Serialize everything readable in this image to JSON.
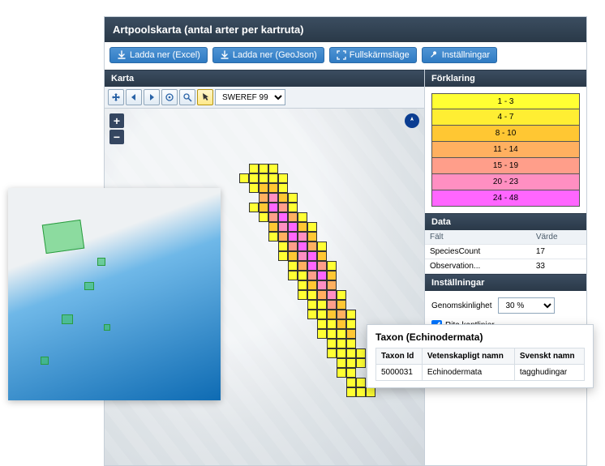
{
  "title": "Artpoolskarta (antal arter per kartruta)",
  "buttons": {
    "excel": "Ladda ner (Excel)",
    "geojson": "Ladda ner (GeoJson)",
    "fullscreen": "Fullskärmsläge",
    "settings": "Inställningar"
  },
  "sections": {
    "map": "Karta",
    "legend": "Förklaring",
    "data": "Data",
    "settings": "Inställningar"
  },
  "map": {
    "coord_sys_selected": "SWEREF 99",
    "zoom_in": "+",
    "zoom_out": "−"
  },
  "legend": {
    "bins": [
      {
        "label": "1 - 3",
        "color": "#ffff33"
      },
      {
        "label": "4 - 7",
        "color": "#ffee33"
      },
      {
        "label": "8 - 10",
        "color": "#ffc733"
      },
      {
        "label": "11 - 14",
        "color": "#ffb060"
      },
      {
        "label": "15 - 19",
        "color": "#ff9e8a"
      },
      {
        "label": "20 - 23",
        "color": "#ff8fc2"
      },
      {
        "label": "24 - 48",
        "color": "#ff66ff"
      }
    ]
  },
  "data_panel": {
    "field_header": "Fält",
    "value_header": "Värde",
    "rows": [
      {
        "field": "SpeciesCount",
        "value": "17"
      },
      {
        "field": "Observation...",
        "value": "33"
      }
    ]
  },
  "settings_panel": {
    "opacity_label": "Genomskinlighet",
    "opacity_selected": "30 %",
    "edges_label": "Rita kantlinjer",
    "edges_checked": true
  },
  "taxon": {
    "popup_title": "Taxon (Echinodermata)",
    "headers": {
      "id": "Taxon Id",
      "sci": "Vetenskapligt namn",
      "sv": "Svenskt namn"
    },
    "row": {
      "id": "5000031",
      "sci": "Echinodermata",
      "sv": "tagghudingar"
    }
  },
  "chart_data": {
    "type": "heatmap",
    "title": "Artpoolskarta (antal arter per kartruta)",
    "value_field": "SpeciesCount",
    "bins": [
      {
        "range": [
          1,
          3
        ],
        "color": "#ffff33"
      },
      {
        "range": [
          4,
          7
        ],
        "color": "#ffee33"
      },
      {
        "range": [
          8,
          10
        ],
        "color": "#ffc733"
      },
      {
        "range": [
          11,
          14
        ],
        "color": "#ffb060"
      },
      {
        "range": [
          15,
          19
        ],
        "color": "#ff9e8a"
      },
      {
        "range": [
          20,
          23
        ],
        "color": "#ff8fc2"
      },
      {
        "range": [
          24,
          48
        ],
        "color": "#ff66ff"
      }
    ],
    "grid": {
      "cols": 18,
      "rows": 30,
      "cells": [
        {
          "c": 4,
          "r": 4,
          "b": 0
        },
        {
          "c": 5,
          "r": 4,
          "b": 0
        },
        {
          "c": 6,
          "r": 4,
          "b": 0
        },
        {
          "c": 3,
          "r": 5,
          "b": 0
        },
        {
          "c": 4,
          "r": 5,
          "b": 0
        },
        {
          "c": 5,
          "r": 5,
          "b": 0
        },
        {
          "c": 6,
          "r": 5,
          "b": 0
        },
        {
          "c": 7,
          "r": 5,
          "b": 0
        },
        {
          "c": 4,
          "r": 6,
          "b": 0
        },
        {
          "c": 5,
          "r": 6,
          "b": 2
        },
        {
          "c": 6,
          "r": 6,
          "b": 2
        },
        {
          "c": 7,
          "r": 6,
          "b": 0
        },
        {
          "c": 5,
          "r": 7,
          "b": 3
        },
        {
          "c": 6,
          "r": 7,
          "b": 5
        },
        {
          "c": 7,
          "r": 7,
          "b": 2
        },
        {
          "c": 8,
          "r": 7,
          "b": 0
        },
        {
          "c": 4,
          "r": 8,
          "b": 0
        },
        {
          "c": 5,
          "r": 8,
          "b": 2
        },
        {
          "c": 6,
          "r": 8,
          "b": 6
        },
        {
          "c": 7,
          "r": 8,
          "b": 4
        },
        {
          "c": 8,
          "r": 8,
          "b": 0
        },
        {
          "c": 5,
          "r": 9,
          "b": 0
        },
        {
          "c": 6,
          "r": 9,
          "b": 4
        },
        {
          "c": 7,
          "r": 9,
          "b": 6
        },
        {
          "c": 8,
          "r": 9,
          "b": 3
        },
        {
          "c": 9,
          "r": 9,
          "b": 0
        },
        {
          "c": 6,
          "r": 10,
          "b": 2
        },
        {
          "c": 7,
          "r": 10,
          "b": 5
        },
        {
          "c": 8,
          "r": 10,
          "b": 6
        },
        {
          "c": 9,
          "r": 10,
          "b": 2
        },
        {
          "c": 10,
          "r": 10,
          "b": 0
        },
        {
          "c": 6,
          "r": 11,
          "b": 0
        },
        {
          "c": 7,
          "r": 11,
          "b": 3
        },
        {
          "c": 8,
          "r": 11,
          "b": 6
        },
        {
          "c": 9,
          "r": 11,
          "b": 5
        },
        {
          "c": 10,
          "r": 11,
          "b": 2
        },
        {
          "c": 7,
          "r": 12,
          "b": 0
        },
        {
          "c": 8,
          "r": 12,
          "b": 4
        },
        {
          "c": 9,
          "r": 12,
          "b": 6
        },
        {
          "c": 10,
          "r": 12,
          "b": 3
        },
        {
          "c": 11,
          "r": 12,
          "b": 0
        },
        {
          "c": 7,
          "r": 13,
          "b": 0
        },
        {
          "c": 8,
          "r": 13,
          "b": 2
        },
        {
          "c": 9,
          "r": 13,
          "b": 5
        },
        {
          "c": 10,
          "r": 13,
          "b": 6
        },
        {
          "c": 11,
          "r": 13,
          "b": 2
        },
        {
          "c": 8,
          "r": 14,
          "b": 0
        },
        {
          "c": 9,
          "r": 14,
          "b": 3
        },
        {
          "c": 10,
          "r": 14,
          "b": 6
        },
        {
          "c": 11,
          "r": 14,
          "b": 4
        },
        {
          "c": 12,
          "r": 14,
          "b": 0
        },
        {
          "c": 8,
          "r": 15,
          "b": 0
        },
        {
          "c": 9,
          "r": 15,
          "b": 0
        },
        {
          "c": 10,
          "r": 15,
          "b": 4
        },
        {
          "c": 11,
          "r": 15,
          "b": 6
        },
        {
          "c": 12,
          "r": 15,
          "b": 2
        },
        {
          "c": 9,
          "r": 16,
          "b": 0
        },
        {
          "c": 10,
          "r": 16,
          "b": 2
        },
        {
          "c": 11,
          "r": 16,
          "b": 5
        },
        {
          "c": 12,
          "r": 16,
          "b": 3
        },
        {
          "c": 9,
          "r": 17,
          "b": 0
        },
        {
          "c": 10,
          "r": 17,
          "b": 0
        },
        {
          "c": 11,
          "r": 17,
          "b": 3
        },
        {
          "c": 12,
          "r": 17,
          "b": 5
        },
        {
          "c": 13,
          "r": 17,
          "b": 0
        },
        {
          "c": 10,
          "r": 18,
          "b": 0
        },
        {
          "c": 11,
          "r": 18,
          "b": 0
        },
        {
          "c": 12,
          "r": 18,
          "b": 4
        },
        {
          "c": 13,
          "r": 18,
          "b": 2
        },
        {
          "c": 10,
          "r": 19,
          "b": 0
        },
        {
          "c": 11,
          "r": 19,
          "b": 0
        },
        {
          "c": 12,
          "r": 19,
          "b": 2
        },
        {
          "c": 13,
          "r": 19,
          "b": 3
        },
        {
          "c": 14,
          "r": 19,
          "b": 0
        },
        {
          "c": 11,
          "r": 20,
          "b": 0
        },
        {
          "c": 12,
          "r": 20,
          "b": 0
        },
        {
          "c": 13,
          "r": 20,
          "b": 2
        },
        {
          "c": 14,
          "r": 20,
          "b": 0
        },
        {
          "c": 11,
          "r": 21,
          "b": 0
        },
        {
          "c": 12,
          "r": 21,
          "b": 0
        },
        {
          "c": 13,
          "r": 21,
          "b": 0
        },
        {
          "c": 14,
          "r": 21,
          "b": 2
        },
        {
          "c": 12,
          "r": 22,
          "b": 0
        },
        {
          "c": 13,
          "r": 22,
          "b": 0
        },
        {
          "c": 14,
          "r": 22,
          "b": 0
        },
        {
          "c": 12,
          "r": 23,
          "b": 0
        },
        {
          "c": 13,
          "r": 23,
          "b": 0
        },
        {
          "c": 14,
          "r": 23,
          "b": 0
        },
        {
          "c": 15,
          "r": 23,
          "b": 0
        },
        {
          "c": 13,
          "r": 24,
          "b": 0
        },
        {
          "c": 14,
          "r": 24,
          "b": 0
        },
        {
          "c": 15,
          "r": 24,
          "b": 0
        },
        {
          "c": 13,
          "r": 25,
          "b": 0
        },
        {
          "c": 14,
          "r": 25,
          "b": 0
        },
        {
          "c": 14,
          "r": 26,
          "b": 0
        },
        {
          "c": 15,
          "r": 26,
          "b": 0
        },
        {
          "c": 14,
          "r": 27,
          "b": 0
        },
        {
          "c": 15,
          "r": 27,
          "b": 0
        },
        {
          "c": 16,
          "r": 27,
          "b": 0
        }
      ]
    }
  }
}
